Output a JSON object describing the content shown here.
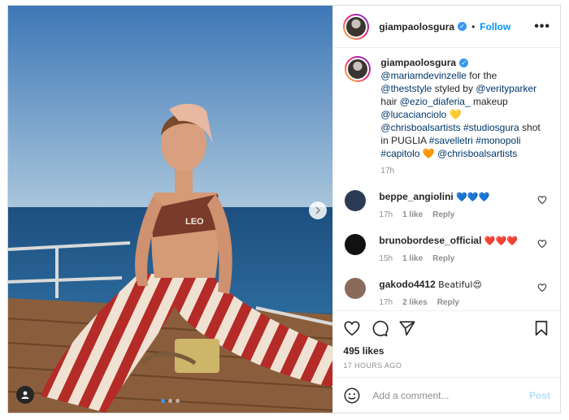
{
  "post": {
    "username": "giampaolosgura",
    "follow_label": "Follow",
    "separator": "•",
    "more_label": "•••",
    "verified_mark": "✓",
    "shirt_text": "LEO",
    "image_count": 3,
    "active_image": 1
  },
  "caption": {
    "username": "giampaolosgura",
    "text_parts": [
      {
        "t": "@mariamdevinzelle",
        "link": true
      },
      {
        "t": " for the ",
        "link": false
      },
      {
        "t": "@theststyle",
        "link": true
      },
      {
        "t": " styled by ",
        "link": false
      },
      {
        "t": "@verityparker",
        "link": true
      },
      {
        "t": " hair ",
        "link": false
      },
      {
        "t": "@ezio_diaferia_",
        "link": true
      },
      {
        "t": " makeup ",
        "link": false
      },
      {
        "t": "@lucacianciolo",
        "link": true
      },
      {
        "t": " 💛 ",
        "link": false
      },
      {
        "t": "@chrisboalsartists",
        "link": true
      },
      {
        "t": " ",
        "link": false
      },
      {
        "t": "#studiosgura",
        "link": true
      },
      {
        "t": " shot in PUGLIA ",
        "link": false
      },
      {
        "t": "#savelletri",
        "link": true
      },
      {
        "t": " ",
        "link": false
      },
      {
        "t": "#monopoli",
        "link": true
      },
      {
        "t": " ",
        "link": false
      },
      {
        "t": "#capitolo",
        "link": true
      },
      {
        "t": " 🧡 ",
        "link": false
      },
      {
        "t": "@chrisboalsartists",
        "link": true
      }
    ],
    "time": "17h"
  },
  "comments": [
    {
      "username": "beppe_angiolini",
      "text": "💙💙💙",
      "time": "17h",
      "likes": "1 like",
      "reply": "Reply",
      "avatar_color": "#2b3a55"
    },
    {
      "username": "brunobordese_official",
      "text": "❤️❤️❤️",
      "time": "15h",
      "likes": "1 like",
      "reply": "Reply",
      "avatar_color": "#111111"
    },
    {
      "username": "gakodo4412",
      "text": "Beatiful😍",
      "time": "17h",
      "likes": "2 likes",
      "reply": "Reply",
      "avatar_color": "#8a6a5a"
    }
  ],
  "actions": {
    "likes": "495 likes",
    "posted_ago": "17 HOURS AGO",
    "icons": [
      "heart-icon",
      "comment-icon",
      "share-icon",
      "bookmark-icon"
    ]
  },
  "add_comment": {
    "placeholder": "Add a comment...",
    "post_label": "Post"
  },
  "colors": {
    "link": "#00376b",
    "follow": "#0095f6",
    "post_disabled": "#b2dffc",
    "muted": "#8e8e8e"
  }
}
